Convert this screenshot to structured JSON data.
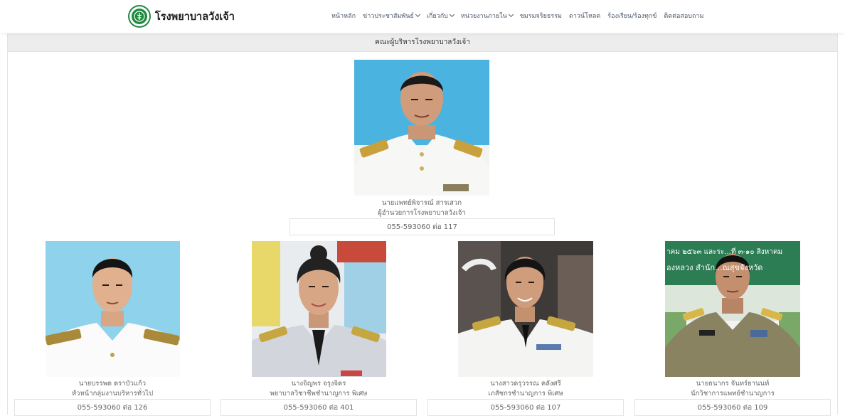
{
  "header": {
    "site_name": "โรงพยาบาลวังเจ้า",
    "nav": [
      {
        "label": "หน้าหลัก",
        "dropdown": false
      },
      {
        "label": "ข่าวประชาสัมพันธ์",
        "dropdown": true
      },
      {
        "label": "เกี่ยวกับ",
        "dropdown": true
      },
      {
        "label": "หน่วยงานภายใน",
        "dropdown": true
      },
      {
        "label": "ชมรมจริยธรรม",
        "dropdown": false
      },
      {
        "label": "ดาวน์โหลด",
        "dropdown": false
      },
      {
        "label": "ร้องเรียน/ร้องทุกข์",
        "dropdown": false
      },
      {
        "label": "ติดต่อสอบถาม",
        "dropdown": false
      }
    ]
  },
  "section": {
    "title": "คณะผู้บริหารโรงพยาบาลวังเจ้า"
  },
  "director": {
    "name": "นายแพทย์พิจารณ์ สารเสวก",
    "role": "ผู้อำนวยการโรงพยาบาลวังเจ้า",
    "phone": "055-593060 ต่อ 117"
  },
  "executives": [
    {
      "name": "นายบรรพต ตราบัวแก้ว",
      "role": "หัวหน้ากลุ่มงานบริหารทั่วไป",
      "phone": "055-593060 ต่อ 126"
    },
    {
      "name": "นางจิญพร จรุงจิตร",
      "role": "พยาบาลวิชาชีพชำนาญการ พิเศษ",
      "phone": "055-593060 ต่อ 401"
    },
    {
      "name": "นางสาวดรุวรรณ คลังศรี",
      "role": "เภสัชกรชำนาญการ พิเศษ",
      "phone": "055-593060 ต่อ 107"
    },
    {
      "name": "นายธนากร จันทร์ยานนท์",
      "role": "นักวิชาการแพทย์ชำนาญการ",
      "phone": "055-593060 ต่อ 109"
    }
  ],
  "photo_banner_text": {
    "line1": "าคม ๒๕๖๓ และระ...ที่ ๓-๑๐ สิงหาคม",
    "line2": "องหลวง สำนัก...ณสุขจังหวัด"
  }
}
